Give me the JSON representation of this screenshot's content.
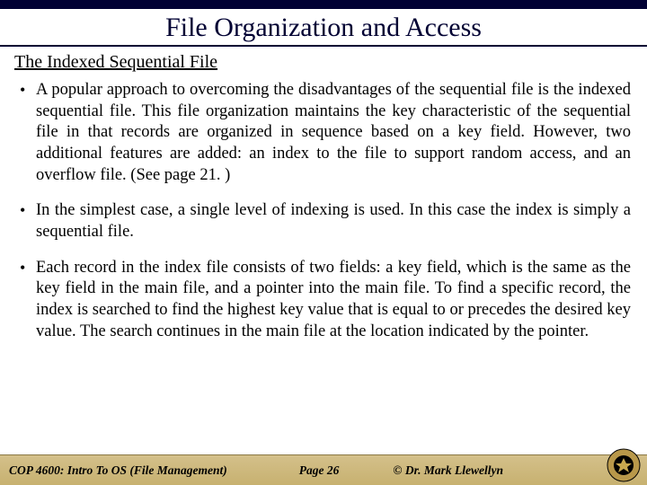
{
  "title": "File Organization and Access",
  "subtitle": "The Indexed Sequential File",
  "bullets": [
    "A popular approach to overcoming the disadvantages of the sequential file is the indexed sequential file.  This file organization maintains the key characteristic of the sequential file in that records are organized in sequence based on a key field.  However, two additional features are added: an index to the file to support random access, and an overflow file. (See page 21. )",
    "In  the simplest case, a single level of indexing is used.  In this case the index is simply a sequential file.",
    "Each record in the index file consists of two fields: a key field, which is the same as the key field in the main file, and a pointer into the main file.  To find a specific record, the index is searched to find the highest key value that is equal to or precedes the desired key value.  The search continues in the main file at the location indicated by the pointer."
  ],
  "footer": {
    "course": "COP 4600: Intro To OS  (File Management)",
    "page": "Page 26",
    "author": "© Dr. Mark Llewellyn"
  }
}
